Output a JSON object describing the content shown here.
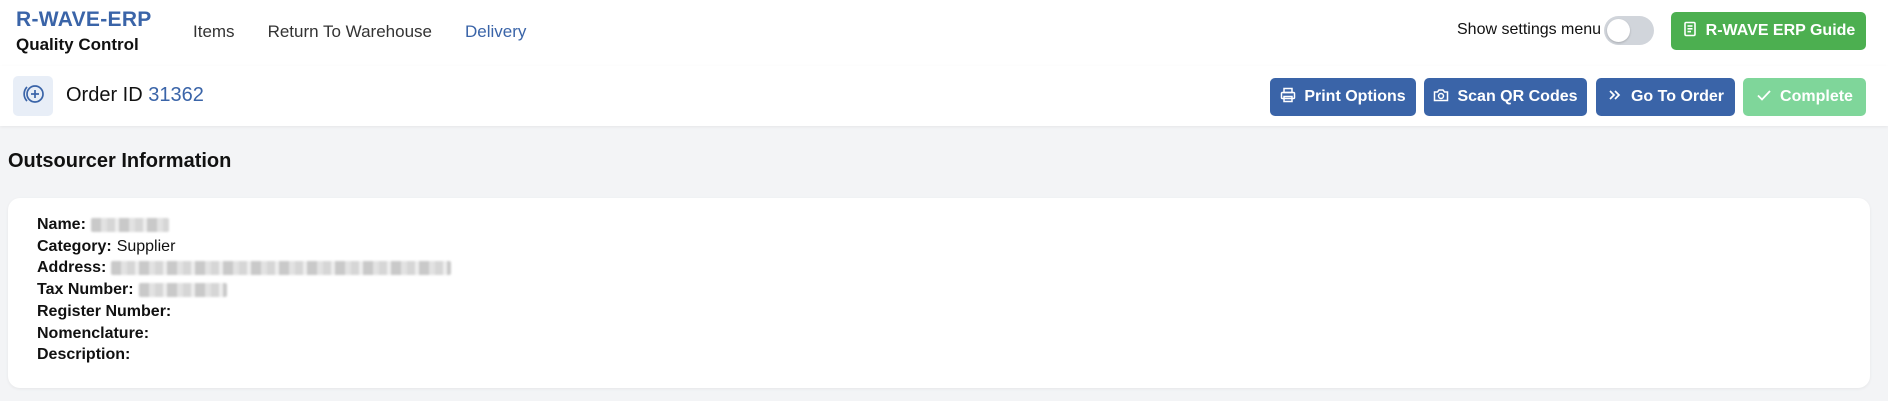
{
  "brand": {
    "title": "R-WAVE-ERP",
    "subtitle": "Quality Control"
  },
  "nav": {
    "items": [
      {
        "label": "Items"
      },
      {
        "label": "Return To Warehouse"
      },
      {
        "label": "Delivery",
        "active": true
      }
    ]
  },
  "settings": {
    "label": "Show settings menu",
    "enabled": false
  },
  "guide_button": {
    "label": "R-WAVE ERP Guide",
    "icon": "book-icon"
  },
  "order": {
    "prefix": "Order ID",
    "id": "31362"
  },
  "actions": {
    "print": {
      "label": "Print Options",
      "icon": "printer-icon"
    },
    "scan": {
      "label": "Scan QR Codes",
      "icon": "camera-icon"
    },
    "goto": {
      "label": "Go To Order",
      "icon": "double-chevron-right-icon"
    },
    "complete": {
      "label": "Complete",
      "icon": "check-icon",
      "disabled": true
    }
  },
  "section": {
    "title": "Outsourcer Information"
  },
  "info": {
    "name_label": "Name:",
    "category_label": "Category:",
    "category_value": "Supplier",
    "address_label": "Address:",
    "tax_label": "Tax Number:",
    "register_label": "Register Number:",
    "nomenclature_label": "Nomenclature:",
    "description_label": "Description:"
  },
  "colors": {
    "primary": "#3a64a8",
    "success": "#4caf50",
    "success_disabled": "#7fd69a",
    "background": "#f3f4f6"
  }
}
